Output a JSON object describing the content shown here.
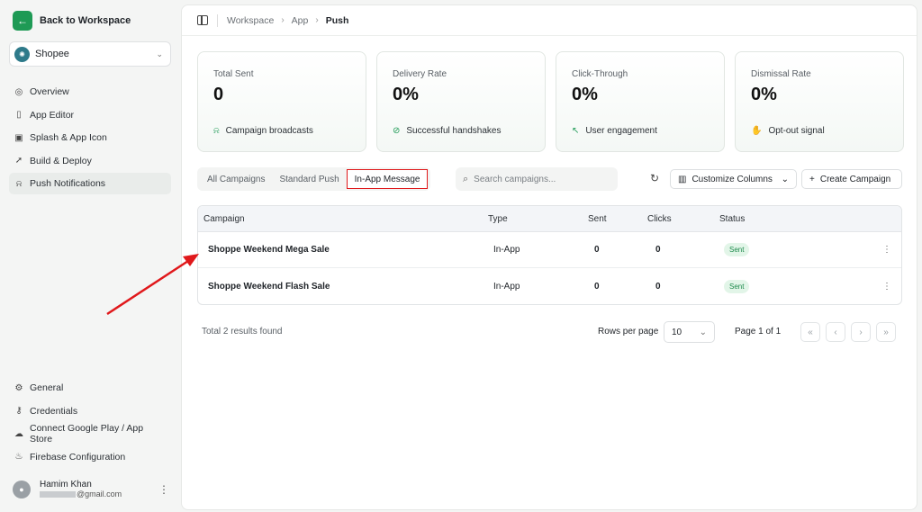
{
  "sidebar": {
    "back_label": "Back to Workspace",
    "app_name": "Shopee",
    "nav": [
      {
        "label": "Overview",
        "icon": "gauge-icon"
      },
      {
        "label": "App Editor",
        "icon": "phone-icon"
      },
      {
        "label": "Splash & App Icon",
        "icon": "image-icon"
      },
      {
        "label": "Build & Deploy",
        "icon": "rocket-icon"
      },
      {
        "label": "Push Notifications",
        "icon": "bell-icon",
        "active": true
      }
    ],
    "nav_bottom": [
      {
        "label": "General",
        "icon": "gear-icon"
      },
      {
        "label": "Credentials",
        "icon": "key-icon"
      },
      {
        "label": "Connect Google Play / App Store",
        "icon": "cloud-icon"
      },
      {
        "label": "Firebase Configuration",
        "icon": "fire-icon"
      }
    ],
    "user": {
      "name": "Hamim Khan",
      "email_suffix": "@gmail.com"
    }
  },
  "breadcrumb": {
    "workspace": "Workspace",
    "app": "App",
    "current": "Push"
  },
  "stats": [
    {
      "label": "Total Sent",
      "value": "0",
      "foot": "Campaign broadcasts",
      "icon": "bell-icon"
    },
    {
      "label": "Delivery Rate",
      "value": "0%",
      "foot": "Successful handshakes",
      "icon": "check-circle-icon"
    },
    {
      "label": "Click-Through",
      "value": "0%",
      "foot": "User engagement",
      "icon": "cursor-icon"
    },
    {
      "label": "Dismissal Rate",
      "value": "0%",
      "foot": "Opt-out signal",
      "icon": "hand-icon"
    }
  ],
  "tabs": [
    "All Campaigns",
    "Standard Push",
    "In-App Message"
  ],
  "search_placeholder": "Search campaigns...",
  "buttons": {
    "columns": "Customize Columns",
    "create": "Create Campaign"
  },
  "table": {
    "headers": [
      "Campaign",
      "Type",
      "Sent",
      "Clicks",
      "Status"
    ],
    "rows": [
      {
        "campaign": "Shoppe Weekend Mega Sale",
        "type": "In-App",
        "sent": "0",
        "clicks": "0",
        "status": "Sent"
      },
      {
        "campaign": "Shoppe Weekend Flash Sale",
        "type": "In-App",
        "sent": "0",
        "clicks": "0",
        "status": "Sent"
      }
    ]
  },
  "footer": {
    "total": "Total 2 results found",
    "rows_label": "Rows per page",
    "rows_value": "10",
    "page_info": "Page 1 of 1"
  },
  "colors": {
    "accent": "#1e9a55",
    "highlight": "#e0181b"
  }
}
